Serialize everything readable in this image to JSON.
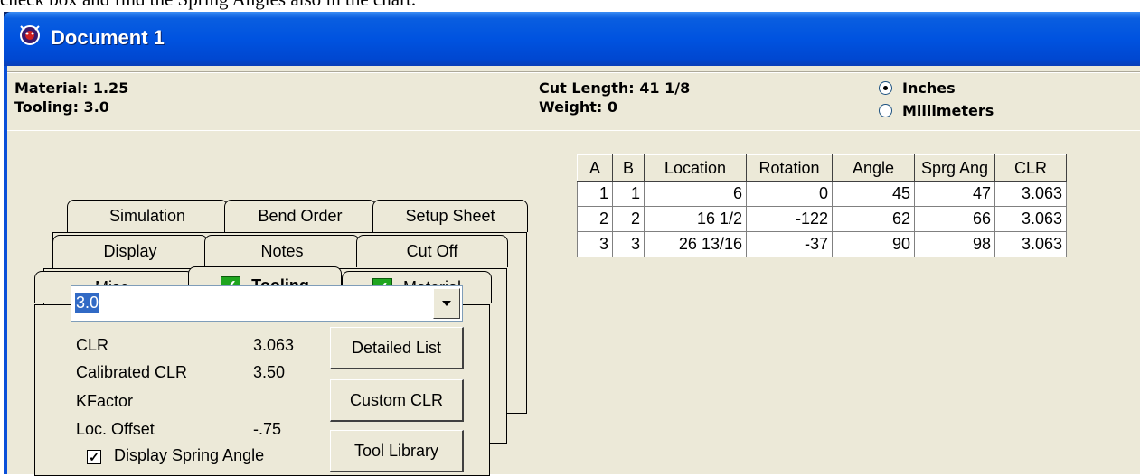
{
  "document_caption": "check box and find the Spring Angles also in the chart.",
  "window": {
    "title": "Document 1"
  },
  "info": {
    "material": "Material: 1.25",
    "tooling": "Tooling: 3.0",
    "cut_length": "Cut Length: 41  1/8",
    "weight": "Weight: 0"
  },
  "units": {
    "options": [
      "Inches",
      "Millimeters"
    ],
    "selected": "Inches"
  },
  "tabs": {
    "row1": [
      "Simulation",
      "Bend Order",
      "Setup Sheet"
    ],
    "row2": [
      "Display",
      "Notes",
      "Cut Off"
    ],
    "row3": [
      "Misc.",
      "Tooling",
      "Material"
    ],
    "active": "Tooling"
  },
  "tooling": {
    "selected_tool": "3.0",
    "properties": [
      {
        "label": "CLR",
        "value": "3.063"
      },
      {
        "label": "Calibrated CLR",
        "value": "3.50"
      },
      {
        "label": "KFactor",
        "value": ""
      },
      {
        "label": "Loc. Offset",
        "value": "-.75"
      }
    ],
    "buttons": [
      "Detailed List",
      "Custom CLR",
      "Tool Library"
    ],
    "display_spring_angle": {
      "label": "Display Spring Angle",
      "checked": true
    }
  },
  "bend_table": {
    "columns": [
      "A",
      "B",
      "Location",
      "Rotation",
      "Angle",
      "Sprg Ang",
      "CLR"
    ],
    "rows": [
      [
        "1",
        "1",
        "6",
        "0",
        "45",
        "47",
        "3.063"
      ],
      [
        "2",
        "2",
        "16  1/2",
        "-122",
        "62",
        "66",
        "3.063"
      ],
      [
        "3",
        "3",
        "26  13/16",
        "-37",
        "90",
        "98",
        "3.063"
      ]
    ]
  }
}
